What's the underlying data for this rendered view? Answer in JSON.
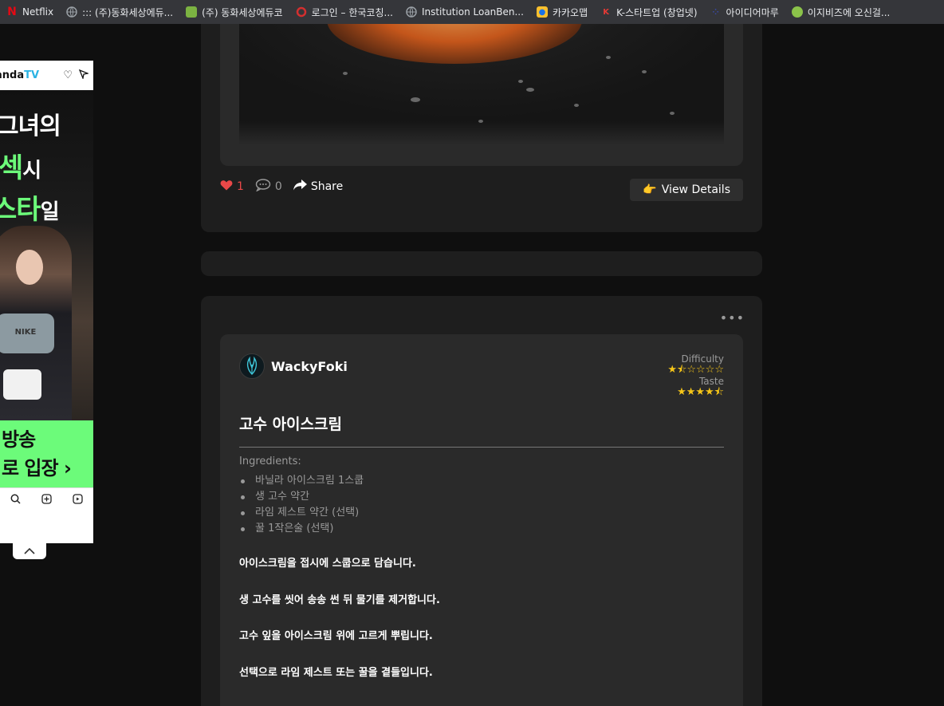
{
  "bookmarks": [
    {
      "label": "Netflix",
      "icon": "netflix-icon",
      "color": "#e50914",
      "glyph": "N"
    },
    {
      "label": "::: (주)동화세상에듀...",
      "icon": "globe-icon",
      "color": "#9aa0a6",
      "glyph": ""
    },
    {
      "label": "(주) 동화세상에듀코",
      "icon": "site-icon",
      "color": "#7cb342",
      "glyph": ""
    },
    {
      "label": "로그인 – 한국코칭...",
      "icon": "ring-icon",
      "color": "#d32f2f",
      "glyph": ""
    },
    {
      "label": "Institution LoanBen...",
      "icon": "globe-icon",
      "color": "#9aa0a6",
      "glyph": ""
    },
    {
      "label": "카카오맵",
      "icon": "kakaomap-icon",
      "color": "#fbc02d",
      "glyph": ""
    },
    {
      "label": "K-스타트업 (창업넷)",
      "icon": "kstartup-icon",
      "color": "#5e35b1",
      "glyph": ""
    },
    {
      "label": "아이디어마루",
      "icon": "idea-icon",
      "color": "#3949ab",
      "glyph": ""
    },
    {
      "label": "이지비즈에 오신걸...",
      "icon": "easybiz-icon",
      "color": "#8bc34a",
      "glyph": ""
    }
  ],
  "ad": {
    "brand": "anda",
    "brand_suffix": "TV",
    "line1": "그녀의",
    "line2_accent": "섹",
    "line2_rest": "시",
    "line3_accent": "스타",
    "line3_rest": "일",
    "shirt_text": "NIKE",
    "cta_line1": "방송",
    "cta_line2": "로 입장 ›"
  },
  "post1": {
    "likes": "1",
    "comments": "0",
    "share_label": "Share",
    "view_details_label": "View Details"
  },
  "post2": {
    "author": "WackyFoki",
    "difficulty_label": "Difficulty",
    "difficulty_stars": "★⯪☆☆☆☆",
    "taste_label": "Taste",
    "taste_stars": "★★★★⯪",
    "title": "고수 아이스크림",
    "ingredients_label": "Ingredients:",
    "ingredients": [
      "바닐라 아이스크림 1스쿱",
      "생 고수 약간",
      "라임 제스트 약간 (선택)",
      "꿀 1작은술 (선택)"
    ],
    "steps": [
      "아이스크림을 접시에 스쿱으로 담습니다.",
      "생 고수를 씻어 송송 썬 뒤 물기를 제거합니다.",
      "고수 잎을 아이스크림 위에 고르게 뿌립니다.",
      "선택으로 라임 제스트 또는 꿀을 곁들입니다."
    ],
    "more_label": "•••"
  },
  "colors": {
    "like": "#e94848",
    "star": "#f5c518",
    "card": "#1e1e1e",
    "inner": "#2a2a2a"
  }
}
